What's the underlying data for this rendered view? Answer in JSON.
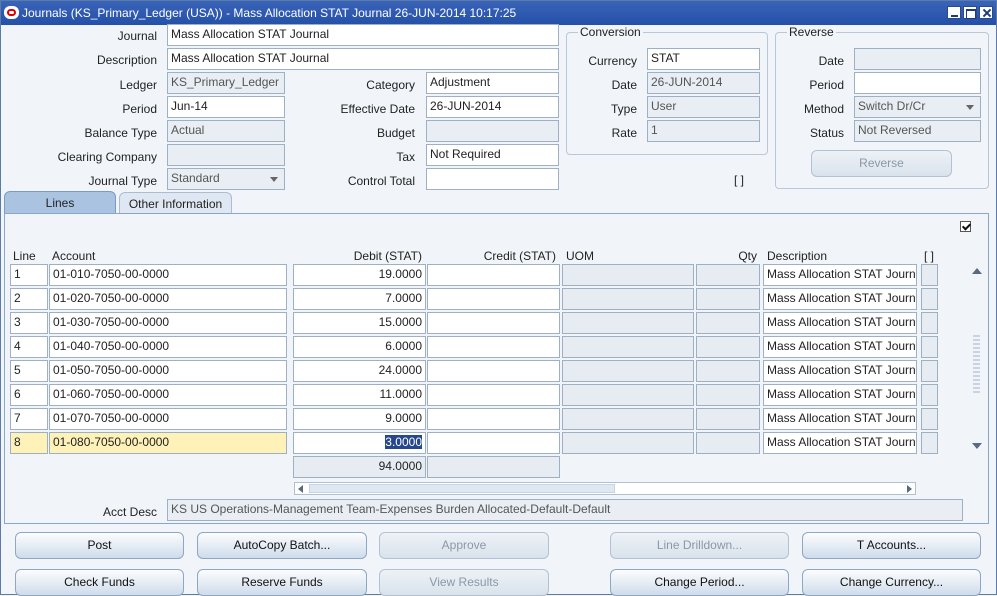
{
  "window": {
    "title": "Journals (KS_Primary_Ledger (USA)) - Mass Allocation STAT Journal 26-JUN-2014 10:17:25"
  },
  "header": {
    "journal_label": "Journal",
    "journal_value": "Mass Allocation STAT Journal",
    "description_label": "Description",
    "description_value": "Mass Allocation STAT Journal",
    "ledger_label": "Ledger",
    "ledger_value": "KS_Primary_Ledger",
    "period_label": "Period",
    "period_value": "Jun-14",
    "balance_type_label": "Balance Type",
    "balance_type_value": "Actual",
    "clearing_company_label": "Clearing Company",
    "clearing_company_value": "",
    "journal_type_label": "Journal Type",
    "journal_type_value": "Standard",
    "category_label": "Category",
    "category_value": "Adjustment",
    "effective_date_label": "Effective Date",
    "effective_date_value": "26-JUN-2014",
    "budget_label": "Budget",
    "budget_value": "",
    "tax_label": "Tax",
    "tax_value": "Not Required",
    "control_total_label": "Control Total",
    "control_total_value": ""
  },
  "conversion": {
    "title": "Conversion",
    "currency_label": "Currency",
    "currency_value": "STAT",
    "date_label": "Date",
    "date_value": "26-JUN-2014",
    "type_label": "Type",
    "type_value": "User",
    "rate_label": "Rate",
    "rate_value": "1",
    "bracket": "[ ]"
  },
  "reverse": {
    "title": "Reverse",
    "date_label": "Date",
    "date_value": "",
    "period_label": "Period",
    "period_value": "",
    "method_label": "Method",
    "method_value": "Switch Dr/Cr",
    "status_label": "Status",
    "status_value": "Not Reversed",
    "reverse_button": "Reverse"
  },
  "tabs": [
    {
      "label": "Lines"
    },
    {
      "label": "Other Information"
    }
  ],
  "lines": {
    "headers": {
      "line": "Line",
      "account": "Account",
      "debit": "Debit (STAT)",
      "credit": "Credit (STAT)",
      "uom": "UOM",
      "qty": "Qty",
      "description": "Description",
      "bracket": "[ ]"
    },
    "rows": [
      {
        "line": "1",
        "account": "01-010-7050-00-0000",
        "debit": "19.0000",
        "credit": "",
        "description": "Mass Allocation STAT Journal"
      },
      {
        "line": "2",
        "account": "01-020-7050-00-0000",
        "debit": "7.0000",
        "credit": "",
        "description": "Mass Allocation STAT Journal"
      },
      {
        "line": "3",
        "account": "01-030-7050-00-0000",
        "debit": "15.0000",
        "credit": "",
        "description": "Mass Allocation STAT Journal"
      },
      {
        "line": "4",
        "account": "01-040-7050-00-0000",
        "debit": "6.0000",
        "credit": "",
        "description": "Mass Allocation STAT Journal"
      },
      {
        "line": "5",
        "account": "01-050-7050-00-0000",
        "debit": "24.0000",
        "credit": "",
        "description": "Mass Allocation STAT Journal"
      },
      {
        "line": "6",
        "account": "01-060-7050-00-0000",
        "debit": "11.0000",
        "credit": "",
        "description": "Mass Allocation STAT Journal"
      },
      {
        "line": "7",
        "account": "01-070-7050-00-0000",
        "debit": "9.0000",
        "credit": "",
        "description": "Mass Allocation STAT Journal"
      },
      {
        "line": "8",
        "account": "01-080-7050-00-0000",
        "debit": "3.0000",
        "credit": "",
        "description": "Mass Allocation STAT Journal"
      }
    ],
    "total_debit": "94.0000",
    "total_credit": "",
    "acct_desc_label": "Acct Desc",
    "acct_desc_value": "KS US Operations-Management Team-Expenses Burden Allocated-Default-Default"
  },
  "buttons": {
    "post": "Post",
    "autocopy": "AutoCopy Batch...",
    "approve": "Approve",
    "line_drilldown": "Line Drilldown...",
    "t_accounts": "T Accounts...",
    "check_funds": "Check Funds",
    "reserve_funds": "Reserve Funds",
    "view_results": "View Results",
    "change_period": "Change Period...",
    "change_currency": "Change Currency..."
  },
  "colors": {
    "title_bar": "#2450a8",
    "current_row": "#fff2b8",
    "selection": "#27478c"
  }
}
